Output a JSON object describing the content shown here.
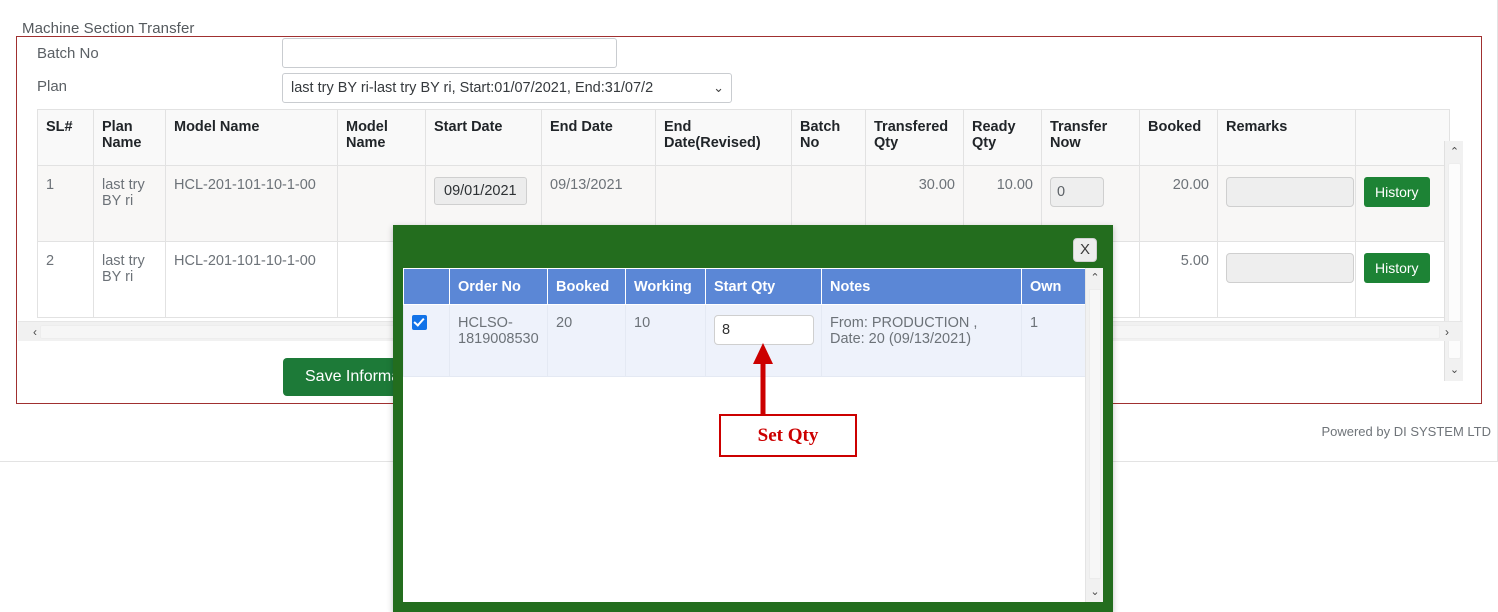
{
  "legend": "Machine Section Transfer",
  "form": {
    "batch_label": "Batch No",
    "batch_value": "",
    "batch_placeholder": "",
    "plan_label": "Plan",
    "plan_selected": "last try BY ri-last try BY ri, Start:01/07/2021, End:31/07/2",
    "caret": "⌄"
  },
  "grid": {
    "headers": [
      "SL#",
      "Plan Name",
      "Model Name",
      "Model Name",
      "Start Date",
      "End Date",
      "End Date(Revised)",
      "Batch No",
      "Transfered Qty",
      "Ready Qty",
      "Transfer Now",
      "Booked",
      "Remarks",
      ""
    ],
    "rows": [
      {
        "sl": "1",
        "plan_name": "last try BY ri",
        "model_name": "HCL-201-101-10-1-00",
        "model_name2": "",
        "start_date": "09/01/2021",
        "end_date": "09/13/2021",
        "end_date_revised": "",
        "batch_no": "",
        "transfered_qty": "30.00",
        "ready_qty": "10.00",
        "transfer_now": "0",
        "booked": "20.00",
        "remarks": "",
        "history_label": "History"
      },
      {
        "sl": "2",
        "plan_name": "last try BY ri",
        "model_name": "HCL-201-101-10-1-00",
        "model_name2": "",
        "start_date": "",
        "end_date": "",
        "end_date_revised": "",
        "batch_no": "",
        "transfered_qty": "",
        "ready_qty": "",
        "transfer_now": "",
        "booked": "5.00",
        "remarks": "",
        "history_label": "History"
      }
    ]
  },
  "scrollbars": {
    "up_arrow": "⌃",
    "down_arrow": "⌄",
    "left_arrow": "‹",
    "right_arrow": "›"
  },
  "save_button_label": "Save Information",
  "footer": "Powered by DI SYSTEM LTD",
  "modal": {
    "close_label": "X",
    "headers": [
      "",
      "Order No",
      "Booked",
      "Working",
      "Start Qty",
      "Notes",
      "Own"
    ],
    "rows": [
      {
        "checked": true,
        "order_no": "HCLSO-1819008530",
        "booked": "20",
        "working": "10",
        "start_qty": "8",
        "notes": "From: PRODUCTION , Date: 20 (09/13/2021)",
        "own": "1"
      }
    ]
  },
  "annotation": {
    "label": "Set Qty"
  },
  "colors": {
    "modal_green": "#236d1e",
    "button_green": "#1d7a38",
    "history_green": "#1d8335",
    "header_blue": "#5b87d6",
    "fieldset_red": "#a03030",
    "annotation_red": "#cc0000"
  }
}
